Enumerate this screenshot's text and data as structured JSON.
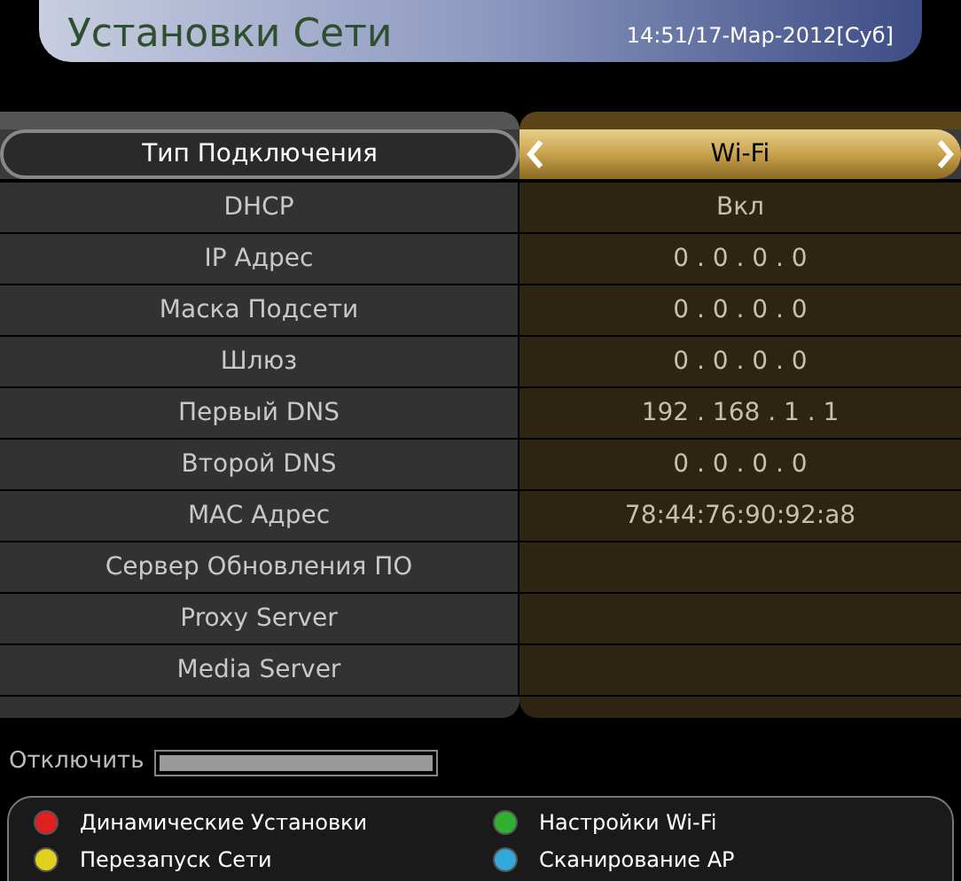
{
  "header": {
    "title": "Установки Сети",
    "datetime": "14:51/17-Мар-2012[Суб]"
  },
  "settings": [
    {
      "label": "Тип Подключения",
      "value": "Wi-Fi",
      "selected": true
    },
    {
      "label": "DHCP",
      "value": "Вкл",
      "selected": false
    },
    {
      "label": "IP Адрес",
      "value": "0 . 0 . 0 . 0",
      "selected": false
    },
    {
      "label": "Маска Подсети",
      "value": "0 . 0 . 0 . 0",
      "selected": false
    },
    {
      "label": "Шлюз",
      "value": "0 . 0 . 0 . 0",
      "selected": false
    },
    {
      "label": "Первый DNS",
      "value": "192 . 168 . 1 . 1",
      "selected": false
    },
    {
      "label": "Второй DNS",
      "value": "0 . 0 . 0 . 0",
      "selected": false
    },
    {
      "label": "MAC Адрес",
      "value": "78:44:76:90:92:a8",
      "selected": false
    },
    {
      "label": "Сервер Обновления ПО",
      "selected": false
    },
    {
      "label": "Proxy Server",
      "selected": false
    },
    {
      "label": "Media Server",
      "selected": false
    }
  ],
  "status": {
    "label": "Отключить",
    "level": 1
  },
  "legend": [
    {
      "label": "Динамические Установки",
      "color": "#e02020"
    },
    {
      "label": "Настройки Wi-Fi",
      "color": "#30b030"
    },
    {
      "label": "Перезапуск Сети",
      "color": "#e0d020"
    },
    {
      "label": "Сканирование AP",
      "color": "#30a8d8"
    }
  ]
}
